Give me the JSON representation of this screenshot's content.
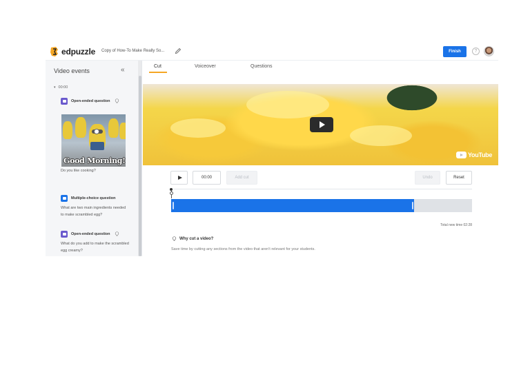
{
  "app": {
    "brand": "edpuzzle",
    "doc_title": "Copy of How-To Make Really So...",
    "finish_label": "Finish",
    "help_label": "?"
  },
  "colors": {
    "accent": "#1a73e8",
    "tab_underline": "#f5a623",
    "open_question": "#6a5acd",
    "multiple_choice": "#1a73e8"
  },
  "sidebar": {
    "title": "Video events",
    "collapse_icon": "«",
    "timestamp": "00:00",
    "events": [
      {
        "type_label": "Open-ended question",
        "text": "Do you like cooking?",
        "thumbnail_text": "Good Morning!"
      },
      {
        "type_label": "Multiple-choice question",
        "text": "What are two main ingredients needed to make scrambled egg?"
      },
      {
        "type_label": "Open-ended question",
        "text": "What do you add to make the scrambled egg creamy?"
      }
    ]
  },
  "tabs": [
    "Cut",
    "Voiceover",
    "Questions"
  ],
  "active_tab": "Cut",
  "video": {
    "watermark": "YouTube"
  },
  "controls": {
    "time": "00:00",
    "add_cut": "Add cut",
    "undo": "Undo",
    "reset": "Reset"
  },
  "timeline": {
    "kept_fraction": 0.807,
    "total_time_label": "Total new time 02:28"
  },
  "info": {
    "title": "Why cut a video?",
    "description": "Save time by cutting any sections from the video that aren't relevant for your students."
  }
}
